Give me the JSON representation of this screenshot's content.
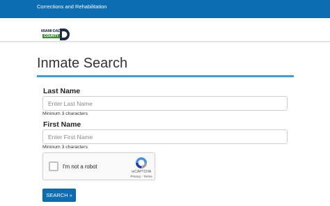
{
  "header": {
    "department": "Corrections and Rehabilitation",
    "logo": {
      "line1": "MIAMI·DADE",
      "line2": "COUNTY",
      "letter": "D",
      "color": "#1f2a44",
      "accent": "#3e8e3a"
    }
  },
  "page": {
    "title": "Inmate Search",
    "rule_color": "#3aa0dc"
  },
  "form": {
    "last_name": {
      "label": "Last Name",
      "placeholder": "Enter Last Name",
      "value": "",
      "hint": "Mininum 3 characters"
    },
    "first_name": {
      "label": "First Name",
      "placeholder": "Enter First Name",
      "value": "",
      "hint": "Mininum 3 characters"
    },
    "captcha": {
      "label": "I'm not a robot",
      "brand": "reCAPTCHA",
      "links": "Privacy - Terms"
    },
    "search_button": "SEARCH »"
  },
  "colors": {
    "primary": "#0c6db3"
  }
}
